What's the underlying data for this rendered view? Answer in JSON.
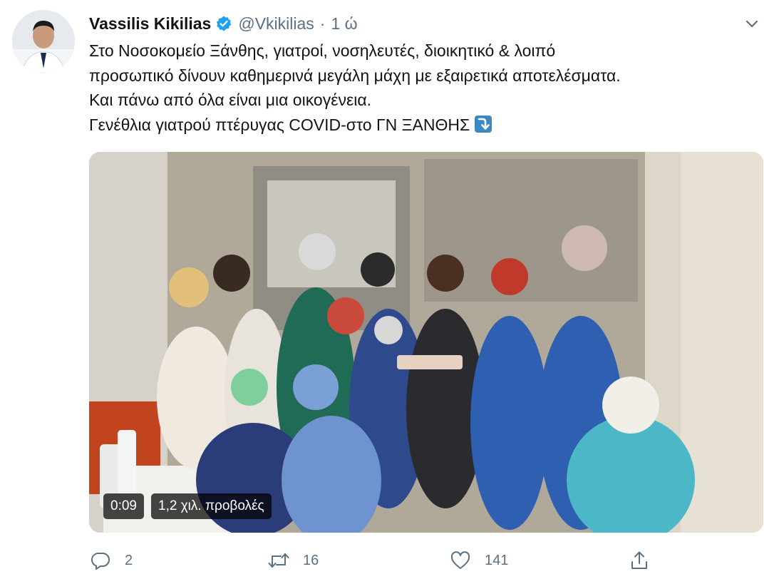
{
  "tweet": {
    "author_name": "Vassilis Kikilias",
    "author_handle": "@Vkikilias",
    "separator": "·",
    "time_ago": "1 ώ",
    "text_lines": [
      "Στο Νοσοκομείο Ξάνθης, γιατροί, νοσηλευτές, διοικητικό & λοιπό",
      "προσωπικό δίνουν καθημερινά μεγάλη μάχη με εξαιρετικά αποτελέσματα.",
      "Και πάνω από όλα είναι μια οικογένεια.",
      "Γενέθλια γιατρού πτέρυγας COVID-στο ΓΝ ΞΑΝΘΗΣ"
    ]
  },
  "video": {
    "duration": "0:09",
    "views": "1,2 χιλ. προβολές"
  },
  "actions": {
    "reply_count": "2",
    "retweet_count": "16",
    "like_count": "141"
  },
  "icons": {
    "verified": "verified-badge-icon",
    "caret": "chevron-down-icon",
    "arrow_emoji": "arrow-heading-down-emoji",
    "reply": "reply-icon",
    "retweet": "retweet-icon",
    "like": "heart-icon",
    "share": "share-icon"
  },
  "colors": {
    "accent": "#1da1f2",
    "text_primary": "#0f1419",
    "text_secondary": "#5b7083",
    "emoji_blue": "#3b88c3"
  }
}
